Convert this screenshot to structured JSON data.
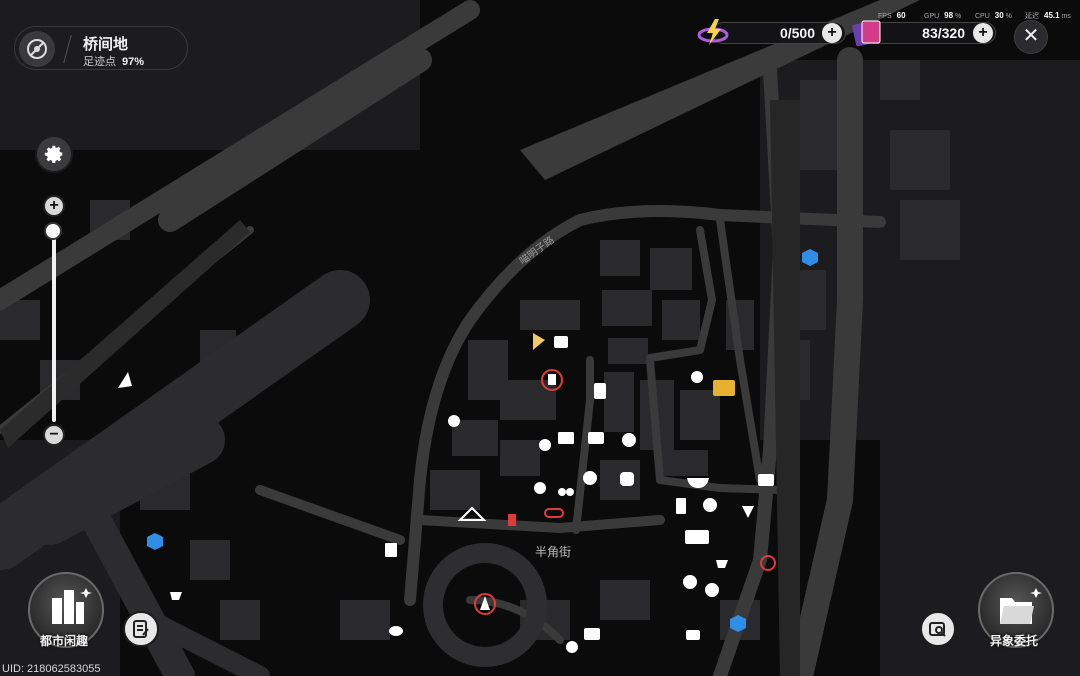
{
  "location": {
    "name": "桥间地",
    "footprint_label": "足迹点",
    "footprint_value": "97%"
  },
  "currencies": [
    {
      "name": "energy",
      "icon": "lightning-orb-icon",
      "value": "0/500"
    },
    {
      "name": "cards",
      "icon": "card-stack-icon",
      "value": "83/320"
    }
  ],
  "performance": {
    "fps_label": "FPS",
    "fps": "60",
    "gpu_label": "GPU",
    "gpu": "98",
    "cpu_label": "CPU",
    "cpu": "30",
    "latency_label": "延迟",
    "latency": "45.1"
  },
  "map": {
    "street_main": "半角街",
    "street_side": "喵明子路"
  },
  "bottom": {
    "city_fun": "都市闲趣",
    "anomaly": "异象委托"
  },
  "uid": "UID: 218062583055",
  "colors": {
    "background": "#0b0b0c",
    "road": "#3a3a3a",
    "building": "#262628",
    "poi_white": "#ffffff",
    "poi_red": "#e03a3a",
    "poi_blue": "#2f8fe6",
    "poi_gold": "#e8b030"
  }
}
